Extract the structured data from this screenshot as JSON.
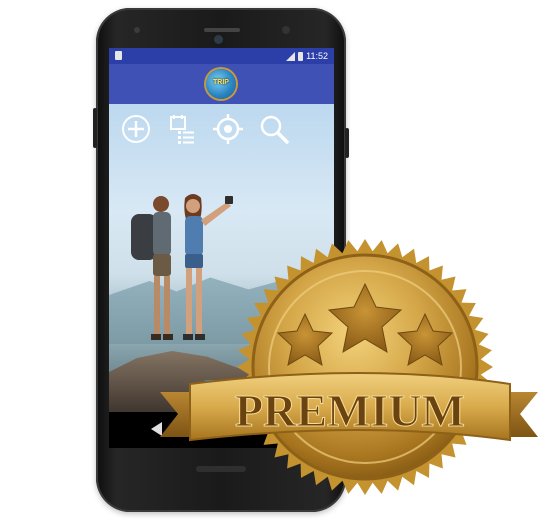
{
  "status_bar": {
    "time": "11:52"
  },
  "app_bar": {
    "logo_text": "TRIP"
  },
  "toolbar": {
    "icons": [
      "add-icon",
      "checklist-icon",
      "location-target-icon",
      "search-icon"
    ]
  },
  "badge": {
    "text": "PREMIUM",
    "star_count": 3
  },
  "colors": {
    "status_bar": "#2c3fa9",
    "app_bar": "#3f51b5",
    "gold": "#c9962e"
  }
}
